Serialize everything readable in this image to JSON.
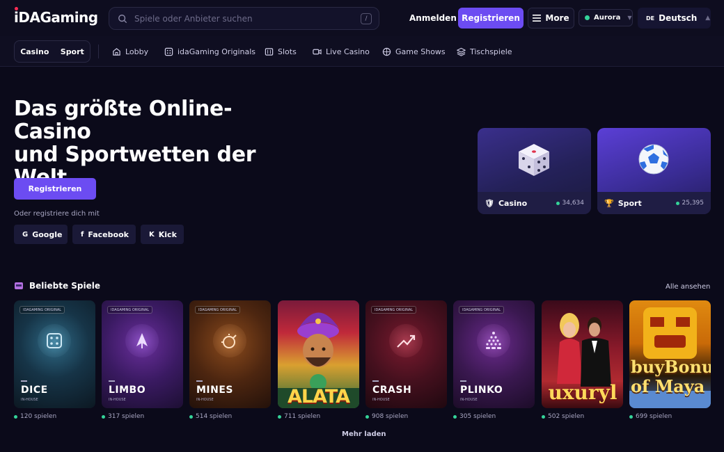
{
  "header": {
    "logo_prefix": "iDA",
    "logo_suffix": "Gaming",
    "search_placeholder": "Spiele oder Anbieter suchen",
    "search_shortcut": "/",
    "login_label": "Anmelden",
    "register_label": "Registrieren",
    "more_label": "More",
    "server_label": "Aurora",
    "language_flag": "DE",
    "language_label": "Deutsch"
  },
  "nav": {
    "segments": [
      "Casino",
      "Sport"
    ],
    "links": [
      "Lobby",
      "idaGaming Originals",
      "Slots",
      "Live Casino",
      "Game Shows",
      "Tischspiele"
    ]
  },
  "hero": {
    "title_line1": "Das größte Online-Casino",
    "title_line2": "und Sportwetten der",
    "title_line3": "Welt",
    "cta_label": "Registrieren",
    "alt_signup": "Oder registriere dich mit",
    "social": [
      {
        "icon": "G",
        "label": "Google"
      },
      {
        "icon": "f",
        "label": "Facebook"
      },
      {
        "icon": "K",
        "label": "Kick"
      }
    ]
  },
  "categories": [
    {
      "label": "Casino",
      "count": "34,634",
      "icon": "shield-icon"
    },
    {
      "label": "Sport",
      "count": "25,395",
      "icon": "trophy-icon"
    }
  ],
  "popular": {
    "title": "Beliebte Spiele",
    "view_all": "Alle ansehen",
    "original_badge": "IDAGAMING ORIGINAL",
    "inhouse_label": "IN-HOUSE",
    "load_more": "Mehr laden",
    "games": [
      {
        "name": "DICE",
        "plays": "120 spielen",
        "original": true
      },
      {
        "name": "LIMBO",
        "plays": "317 spielen",
        "original": true
      },
      {
        "name": "MINES",
        "plays": "514 spielen",
        "original": true
      },
      {
        "name": "ALATA",
        "plays": "711 spielen",
        "original": false
      },
      {
        "name": "CRASH",
        "plays": "908 spielen",
        "original": true
      },
      {
        "name": "PLINKO",
        "plays": "305 spielen",
        "original": true
      },
      {
        "name": "uxuryl",
        "plays": "502 spielen",
        "original": false
      },
      {
        "name": "buyBonu of Maya",
        "plays": "699 spielen",
        "original": false
      }
    ]
  },
  "colors": {
    "background": "#0b0a1a",
    "accent": "#6c4cf2",
    "online_dot": "#34d399"
  }
}
